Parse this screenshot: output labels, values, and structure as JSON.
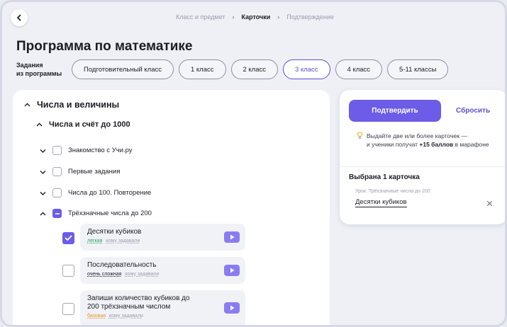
{
  "breadcrumb": {
    "step1": "Класс и предмет",
    "step2": "Карточки",
    "step3": "Подтверждение",
    "separator": "›"
  },
  "page": {
    "title": "Программа по математике"
  },
  "grades": {
    "label_line1": "Задания",
    "label_line2": "из программы",
    "items": [
      {
        "label": "Подготовительный класс",
        "active": false
      },
      {
        "label": "1 класс",
        "active": false
      },
      {
        "label": "2 класс",
        "active": false
      },
      {
        "label": "3 класс",
        "active": true
      },
      {
        "label": "4 класс",
        "active": false
      },
      {
        "label": "5-11 классы",
        "active": false
      }
    ]
  },
  "tree": {
    "section": "Числа и величины",
    "subsection": "Числа и счёт до 1000",
    "topics": [
      {
        "label": "Знакомство с Учи.ру",
        "expanded": false,
        "state": "unchecked"
      },
      {
        "label": "Первые задания",
        "expanded": false,
        "state": "unchecked"
      },
      {
        "label": "Числа до 100. Повторение",
        "expanded": false,
        "state": "unchecked"
      },
      {
        "label": "Трёхзначные числа до 200",
        "expanded": true,
        "state": "partial"
      }
    ],
    "cards": [
      {
        "title": "Десятки кубиков",
        "level": "легкая",
        "level_color": "#20a35a",
        "who": "кому задавали",
        "checked": true
      },
      {
        "title": "Последовательность",
        "level": "очень сложная",
        "level_color": "#1c1d24",
        "who": "кому задавали",
        "checked": false
      },
      {
        "title_line1": "Запиши количество кубиков до",
        "title_line2": "200 трёхзначным числом",
        "level": "базовая",
        "level_color": "#e8932a",
        "who": "кому задавали",
        "checked": false
      }
    ]
  },
  "side": {
    "confirm_label": "Подтвердить",
    "reset_label": "Сбросить",
    "hint_line1": "Выдайте две или более карточек —",
    "hint_line2_pre": "и ученики получат ",
    "hint_bold": "+15 баллов",
    "hint_line2_post": " в марафоне",
    "selected_title": "Выбрана 1 карточка",
    "selected_lesson": "Урок: Трёхзначные числа до 200",
    "selected_item": "Десятки кубиков"
  },
  "colors": {
    "accent": "#6c5ce7",
    "accent_dark": "#5b4fd1",
    "play": "#8a7cf0"
  },
  "icons": [
    "back-arrow-icon",
    "chevron-up-icon",
    "chevron-down-icon",
    "check-icon",
    "minus-icon",
    "play-icon",
    "lightbulb-icon",
    "close-icon"
  ]
}
